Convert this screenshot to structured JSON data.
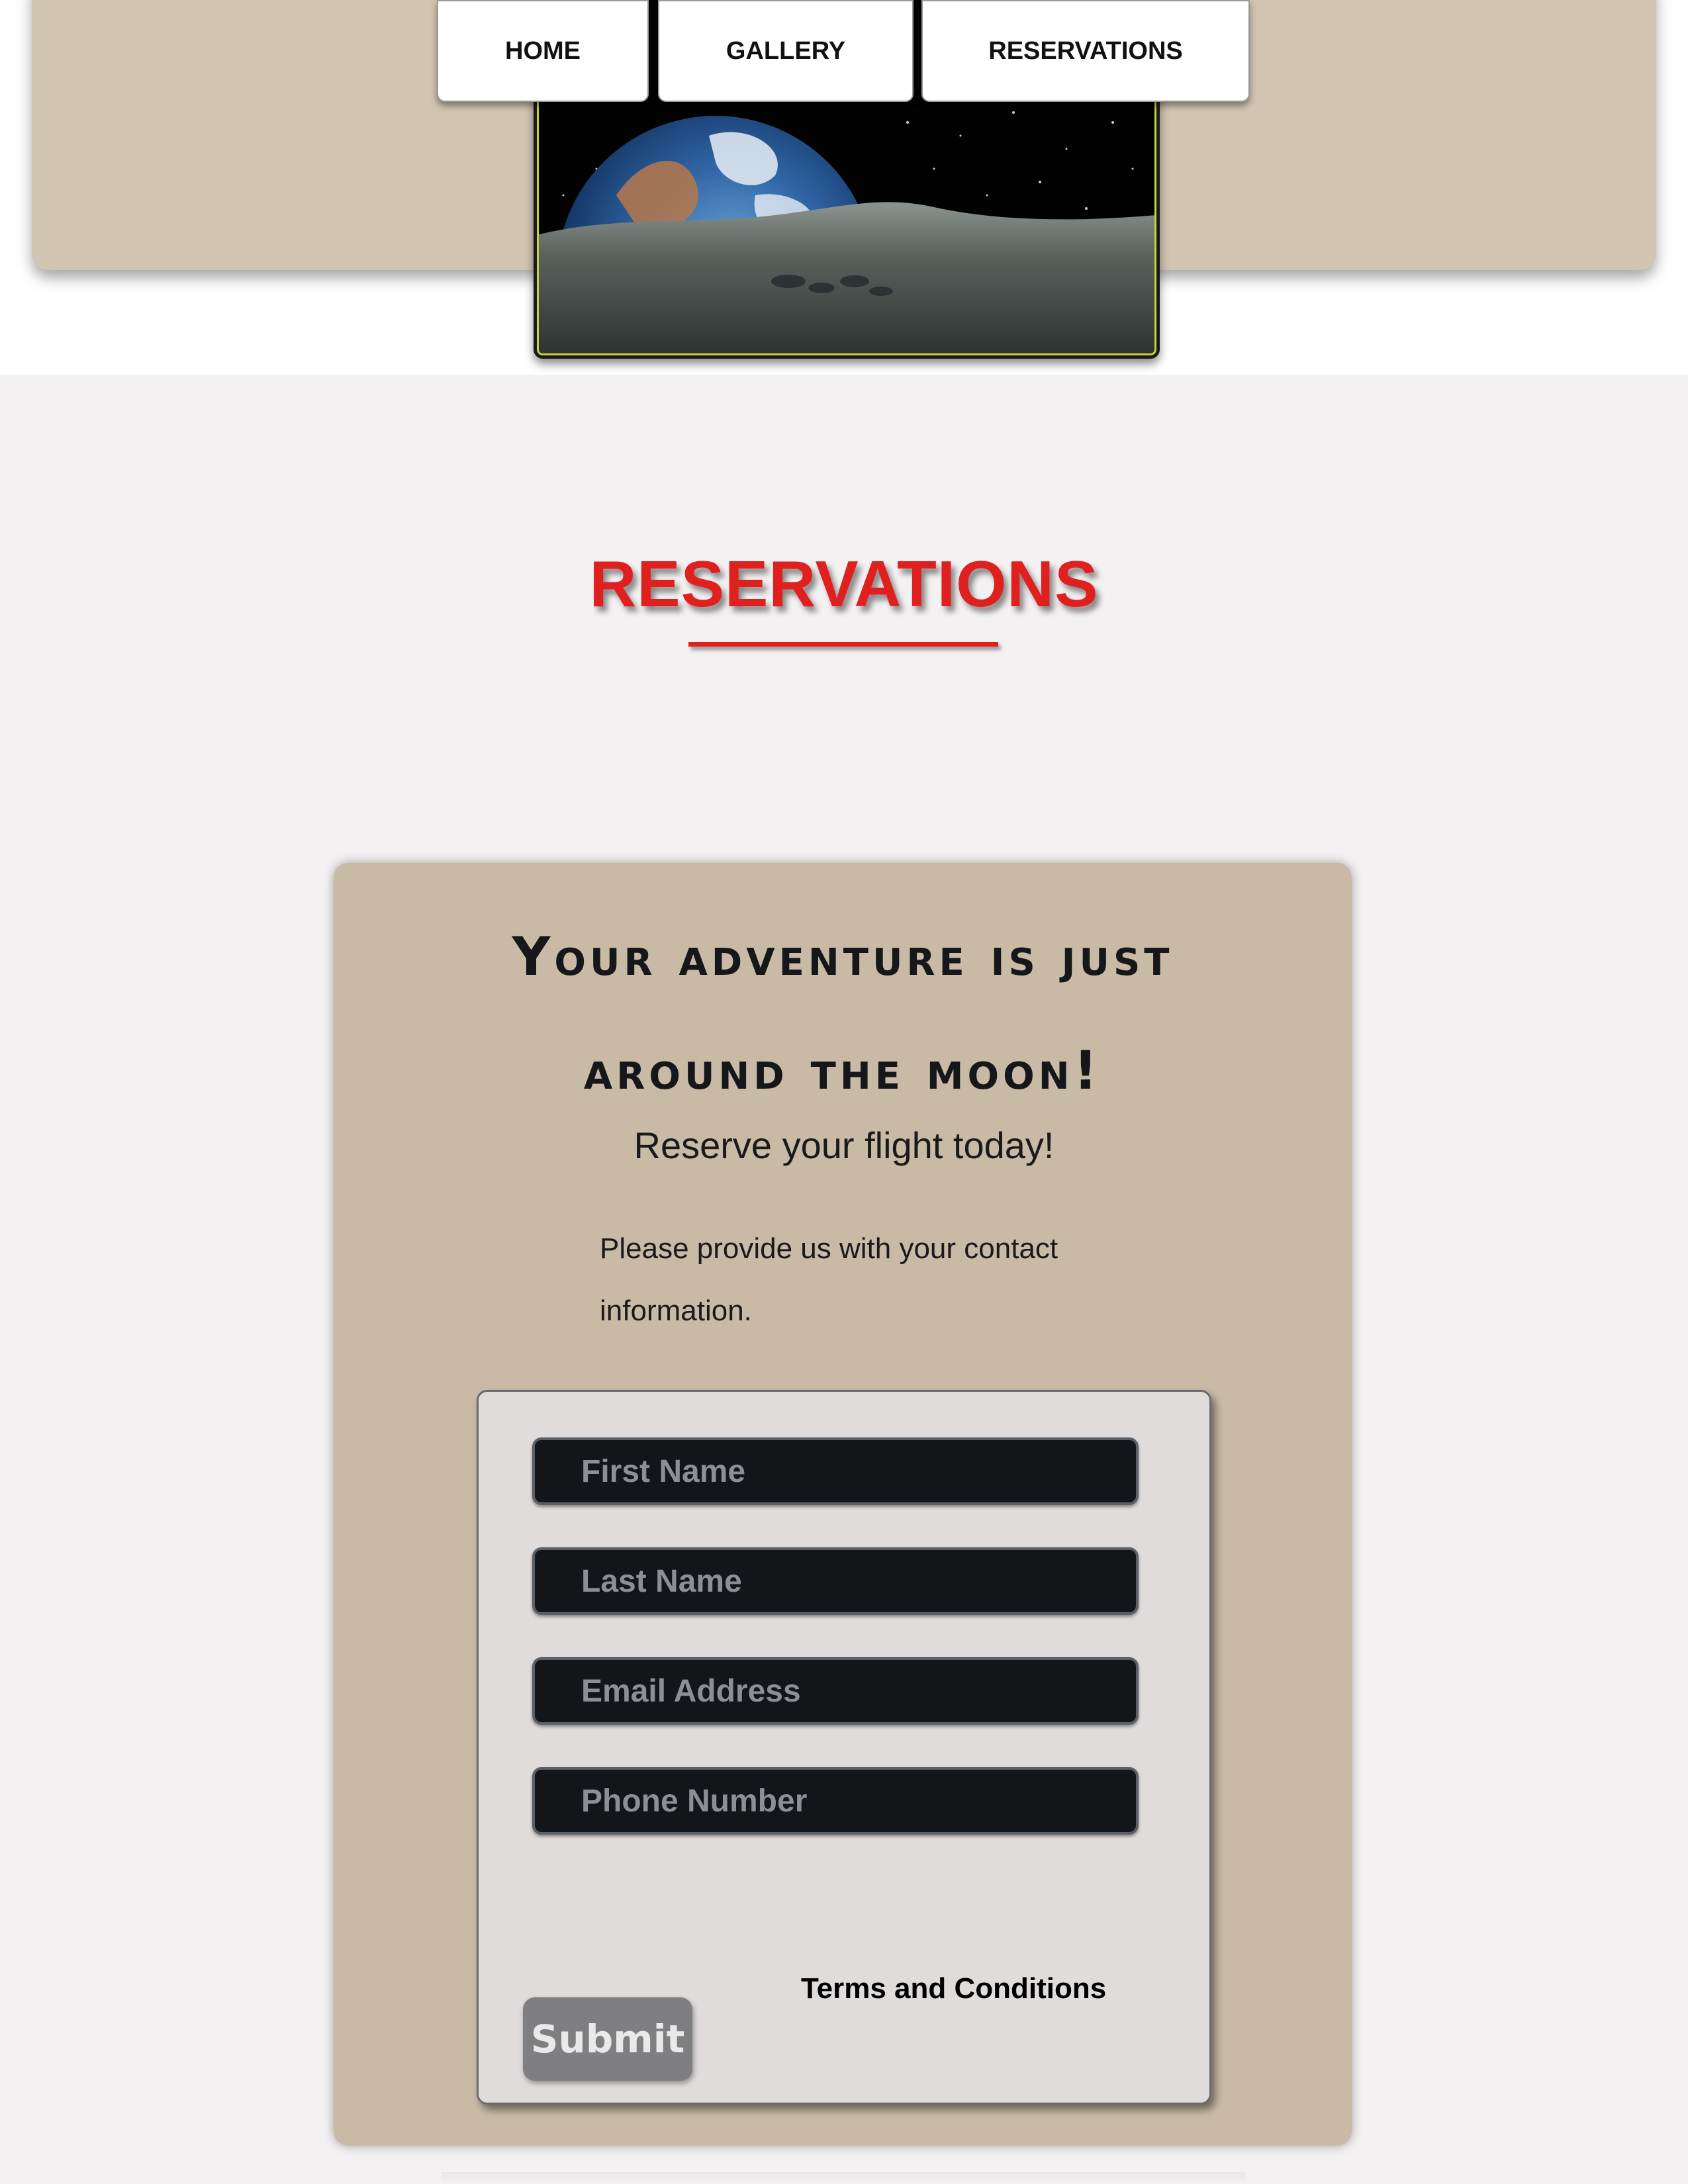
{
  "nav": {
    "items": [
      {
        "label": "HOME"
      },
      {
        "label": "GALLERY"
      },
      {
        "label": "RESERVATIONS"
      }
    ]
  },
  "hero": {
    "image_alt": "Earth rising over the lunar surface"
  },
  "page": {
    "title": "RESERVATIONS"
  },
  "card": {
    "heading": "Your adventure is just around the moon!",
    "subheading": "Reserve your flight today!",
    "note": "Please provide us with your contact information."
  },
  "form": {
    "first_name_placeholder": "First Name",
    "last_name_placeholder": "Last Name",
    "email_placeholder": "Email Address",
    "phone_placeholder": "Phone Number",
    "terms_label": "Terms and Conditions",
    "submit_label": "Submit"
  },
  "colors": {
    "accent_red": "#e0201f",
    "header_tan": "#d1c5b1",
    "card_tan": "#c8baa5",
    "form_bg": "#e0dcdb",
    "input_bg": "#131519",
    "submit_gray": "#7f7f81"
  }
}
